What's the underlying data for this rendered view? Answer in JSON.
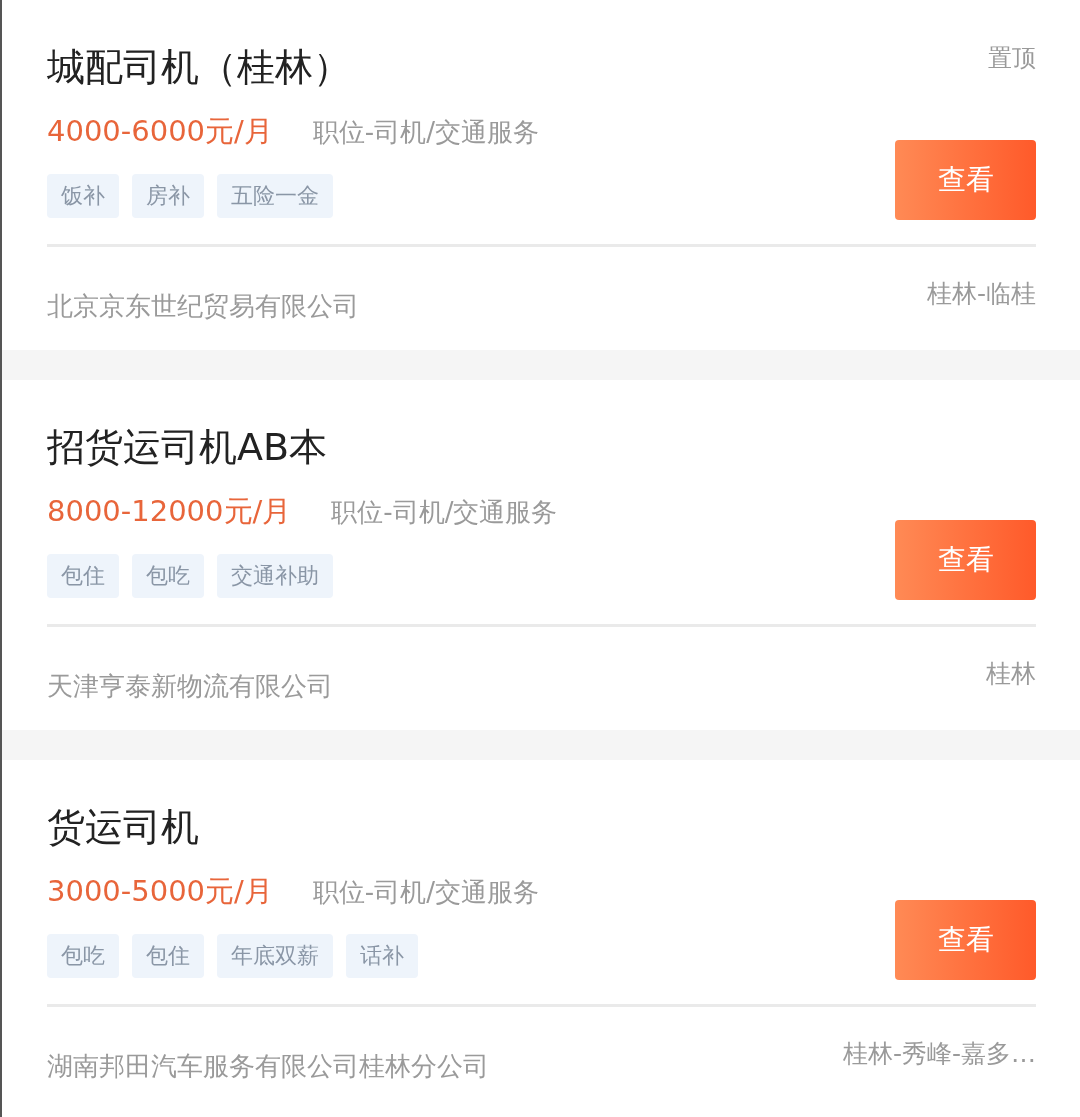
{
  "jobs": [
    {
      "title": "城配司机（桂林）",
      "badge": "置顶",
      "salary": "4000-6000元/月",
      "category": "职位-司机/交通服务",
      "tags": [
        "饭补",
        "房补",
        "五险一金"
      ],
      "button": "查看",
      "company": "北京京东世纪贸易有限公司",
      "location": "桂林-临桂"
    },
    {
      "title": "招货运司机AB本",
      "salary": "8000-12000元/月",
      "category": "职位-司机/交通服务",
      "tags": [
        "包住",
        "包吃",
        "交通补助"
      ],
      "button": "查看",
      "company": "天津亨泰新物流有限公司",
      "location": "桂林"
    },
    {
      "title": "货运司机",
      "salary": "3000-5000元/月",
      "category": "职位-司机/交通服务",
      "tags": [
        "包吃",
        "包住",
        "年底双薪",
        "话补"
      ],
      "button": "查看",
      "company": "湖南邦田汽车服务有限公司桂林分公司",
      "location": "桂林-秀峰-嘉多…"
    }
  ]
}
